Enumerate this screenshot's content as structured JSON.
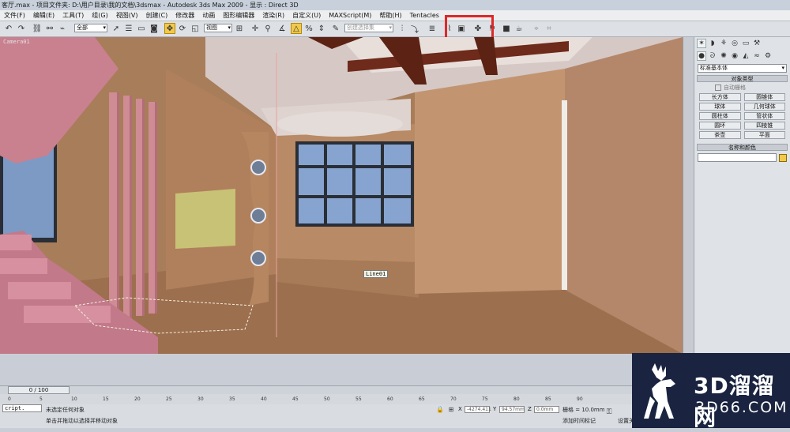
{
  "window": {
    "title": "客厅.max    - 项目文件夹: D:\\用户目录\\我的文档\\3dsmax    - Autodesk 3ds Max  2009       - 显示 : Direct 3D"
  },
  "menu": [
    "文件(F)",
    "编辑(E)",
    "工具(T)",
    "组(G)",
    "视图(V)",
    "创建(C)",
    "修改器",
    "动画",
    "图形编辑器",
    "渲染(R)",
    "自定义(U)",
    "MAXScript(M)",
    "帮助(H)",
    "Tentacles"
  ],
  "toolbar": {
    "selection_filter": "全部",
    "reference_coord": "视图",
    "named_selection": "创建选择集",
    "icons": [
      "undo-icon",
      "redo-icon",
      "link-icon",
      "unlink-icon",
      "bind-icon",
      "select-icon",
      "select-by-name-icon",
      "rect-select-icon",
      "window-crossing-icon",
      "move-icon",
      "rotate-icon",
      "scale-icon",
      "pivot-icon",
      "manipulate-icon",
      "snap-icon",
      "angle-snap-icon",
      "percent-snap-icon",
      "spinner-snap-icon",
      "edit-named-sel-icon",
      "mirror-icon",
      "align-icon",
      "layer-icon",
      "curve-editor-icon",
      "schematic-view-icon",
      "material-editor-icon",
      "render-setup-icon",
      "render-frame-icon",
      "quick-render-icon",
      "teapot-icon"
    ]
  },
  "viewport": {
    "label": "Camera01",
    "object_label": "Line01"
  },
  "command_panel": {
    "category": "标准基本体",
    "object_type_header": "对象类型",
    "autogrid_label": "自动栅格",
    "buttons": [
      "长方体",
      "圆锥体",
      "球体",
      "几何球体",
      "圆柱体",
      "管状体",
      "圆环",
      "四棱锥",
      "茶壶",
      "平面"
    ],
    "name_color_header": "名称和颜色",
    "object_color": "#f2c94c"
  },
  "timeline": {
    "frame_display": "0 / 100",
    "ticks": [
      "0",
      "5",
      "10",
      "15",
      "20",
      "25",
      "30",
      "35",
      "40",
      "45",
      "50",
      "55",
      "60",
      "65",
      "70",
      "75",
      "80",
      "85",
      "90"
    ]
  },
  "status": {
    "script_label": "cript.",
    "selection_msg": "未选定任何对象",
    "prompt_msg": "单击并拖动以选择并移动对象",
    "x_value": "-4274.411",
    "y_value": "94.57mm",
    "z_value": "0.0mm",
    "grid_label": "栅格 = 10.0mm",
    "add_time_tag": "添加时间标记",
    "set_key": "设置关"
  },
  "watermark": {
    "text_main": "3D溜溜网",
    "text_sub": "3D66.COM"
  }
}
